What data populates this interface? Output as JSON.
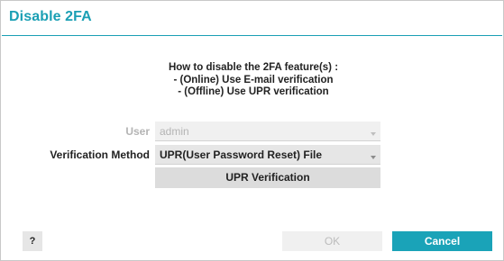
{
  "dialog": {
    "title": "Disable 2FA",
    "accent_color": "#1a9fb4"
  },
  "instructions": {
    "line1": "How to disable the 2FA feature(s) :",
    "line2": "- (Online) Use E-mail verification",
    "line3": "- (Offline) Use UPR verification"
  },
  "form": {
    "user": {
      "label": "User",
      "value": "admin",
      "state": "disabled"
    },
    "verification_method": {
      "label": "Verification Method",
      "value": "UPR(User Password Reset) File",
      "state": "enabled"
    },
    "upr_button_label": "UPR Verification"
  },
  "footer": {
    "help_label": "?",
    "ok_label": "OK",
    "ok_state": "disabled",
    "cancel_label": "Cancel",
    "cancel_color": "#1aa3b8"
  }
}
